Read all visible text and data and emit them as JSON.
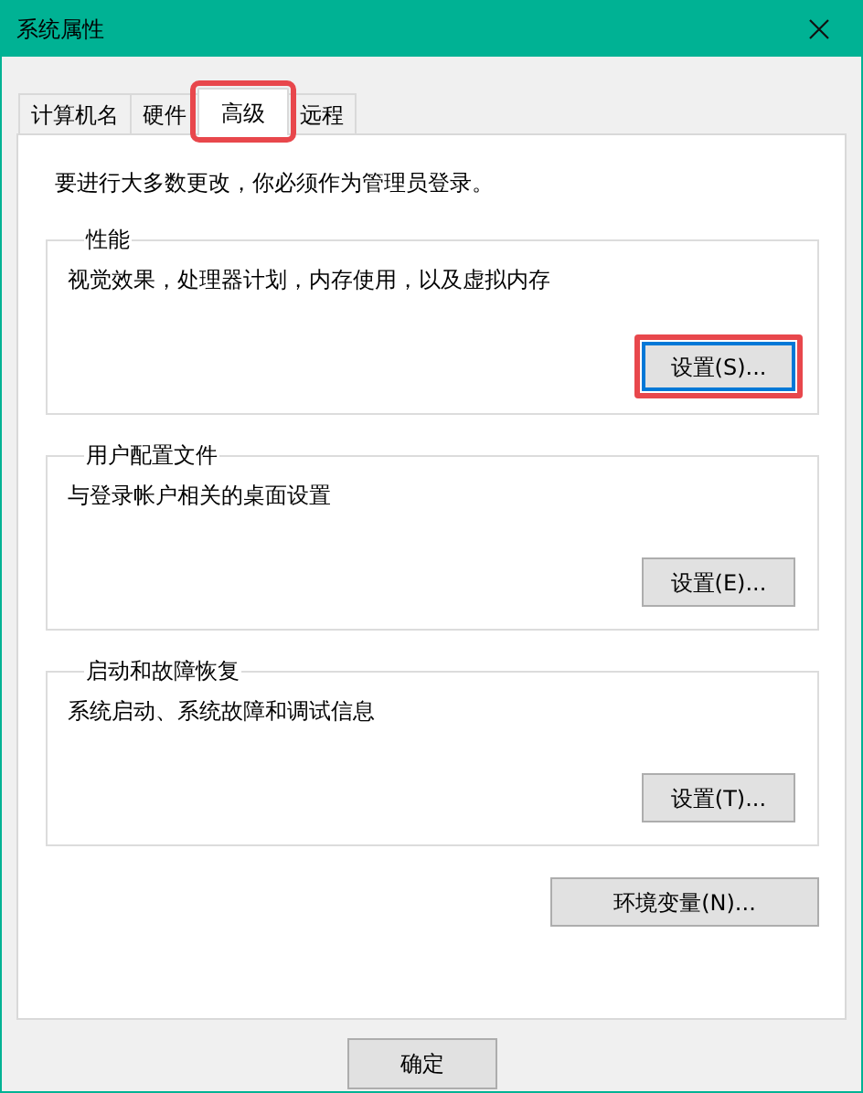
{
  "window": {
    "title": "系统属性"
  },
  "tabs": [
    {
      "label": "计算机名",
      "selected": false,
      "highlighted": false
    },
    {
      "label": "硬件",
      "selected": false,
      "highlighted": false
    },
    {
      "label": "高级",
      "selected": true,
      "highlighted": true
    },
    {
      "label": "远程",
      "selected": false,
      "highlighted": false
    }
  ],
  "notice": "要进行大多数更改，你必须作为管理员登录。",
  "groups": [
    {
      "title": "性能",
      "description": "视觉效果，处理器计划，内存使用，以及虚拟内存",
      "button": {
        "label": "设置(S)...",
        "focused": true,
        "highlighted": true
      }
    },
    {
      "title": "用户配置文件",
      "description": "与登录帐户相关的桌面设置",
      "button": {
        "label": "设置(E)...",
        "focused": false,
        "highlighted": false
      }
    },
    {
      "title": "启动和故障恢复",
      "description": "系统启动、系统故障和调试信息",
      "button": {
        "label": "设置(T)...",
        "focused": false,
        "highlighted": false
      }
    }
  ],
  "environment_button": "环境变量(N)...",
  "dialog_buttons": [
    "确定"
  ]
}
